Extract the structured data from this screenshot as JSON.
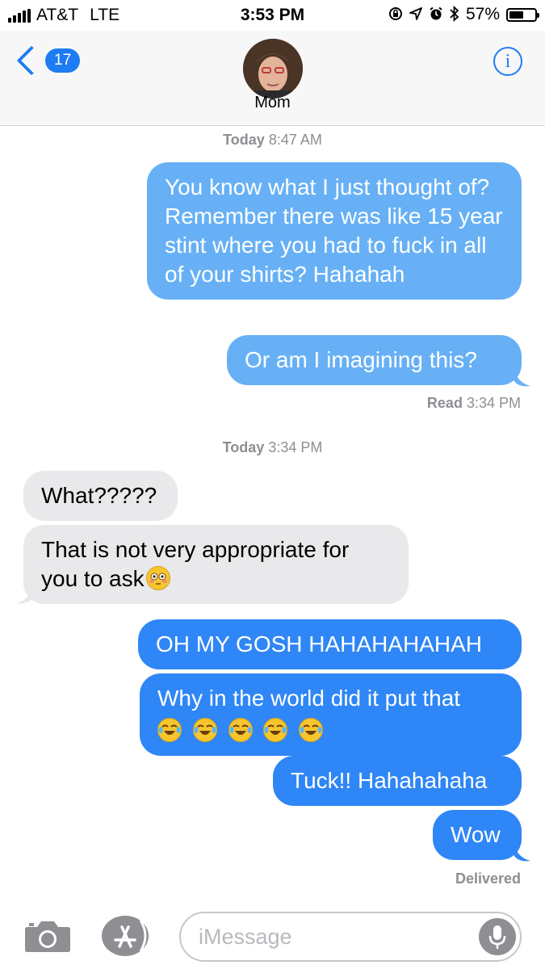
{
  "status_bar": {
    "carrier": "AT&T",
    "network": "LTE",
    "time": "3:53 PM",
    "battery_percent": "57%",
    "battery_level": 0.57
  },
  "header": {
    "back_count": "17",
    "contact_name": "Mom",
    "info_icon": "i"
  },
  "timestamps": [
    {
      "day": "Today",
      "time": "8:47 AM"
    },
    {
      "day": "Today",
      "time": "3:34 PM"
    }
  ],
  "messages": [
    {
      "from": "me",
      "text": "You know what I just thought of? Remember there was like 15 year stint where you had to fuck in all of your shirts? Hahahah"
    },
    {
      "from": "me",
      "text": "Or am I imagining this?"
    },
    {
      "from": "them",
      "text": "What?????"
    },
    {
      "from": "them",
      "text": "That is not very appropriate for you to ask"
    },
    {
      "from": "me",
      "text": "OH MY GOSH HAHAHAHAHAH"
    },
    {
      "from": "me",
      "text": "Why in the world did it put that"
    },
    {
      "from": "me",
      "text": "Tuck!! Hahahahaha"
    },
    {
      "from": "me",
      "text": "Wow"
    }
  ],
  "receipts": {
    "read_label": "Read",
    "read_time": "3:34 PM",
    "delivered_label": "Delivered"
  },
  "input": {
    "placeholder": "iMessage"
  },
  "colors": {
    "accent": "#1e7cf2",
    "sent_bubble_light": "#67b0f5",
    "sent_bubble_dark": "#2f86f6",
    "received_bubble": "#e9e9eb"
  },
  "icons": {
    "camera": "camera-icon",
    "app_store": "app-store-icon",
    "microphone": "microphone-icon",
    "flushed_emoji": "flushed-face-emoji",
    "laughing_emoji": "tears-of-joy-emoji"
  }
}
